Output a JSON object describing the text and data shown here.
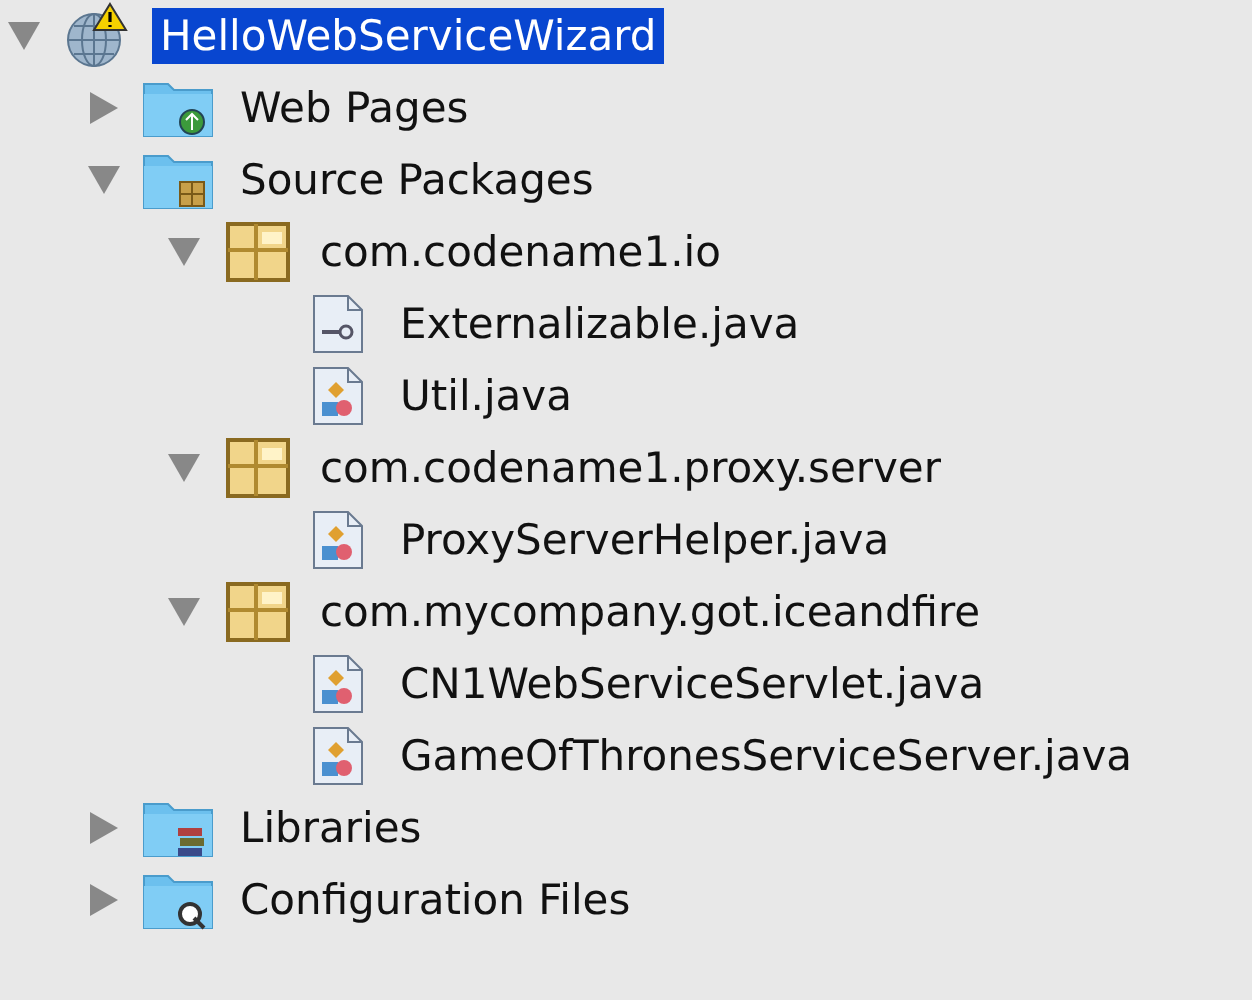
{
  "tree": [
    {
      "label": "HelloWebServiceWizard",
      "kind": "project",
      "expanded": true,
      "selected": true,
      "children": [
        {
          "label": "Web Pages",
          "kind": "web-folder",
          "expanded": false,
          "selected": false
        },
        {
          "label": "Source Packages",
          "kind": "source-folder",
          "expanded": true,
          "selected": false,
          "children": [
            {
              "label": "com.codename1.io",
              "kind": "package",
              "expanded": true,
              "selected": false,
              "children": [
                {
                  "label": "Externalizable.java",
                  "kind": "interface-file",
                  "selected": false
                },
                {
                  "label": "Util.java",
                  "kind": "class-file",
                  "selected": false
                }
              ]
            },
            {
              "label": "com.codename1.proxy.server",
              "kind": "package",
              "expanded": true,
              "selected": false,
              "children": [
                {
                  "label": "ProxyServerHelper.java",
                  "kind": "class-file",
                  "selected": false
                }
              ]
            },
            {
              "label": "com.mycompany.got.iceandfire",
              "kind": "package",
              "expanded": true,
              "selected": false,
              "children": [
                {
                  "label": "CN1WebServiceServlet.java",
                  "kind": "class-file",
                  "selected": false
                },
                {
                  "label": "GameOfThronesServiceServer.java",
                  "kind": "class-file",
                  "selected": false
                }
              ]
            }
          ]
        },
        {
          "label": "Libraries",
          "kind": "library-folder",
          "expanded": false,
          "selected": false
        },
        {
          "label": "Configuration Files",
          "kind": "config-folder",
          "expanded": false,
          "selected": false
        }
      ]
    }
  ]
}
